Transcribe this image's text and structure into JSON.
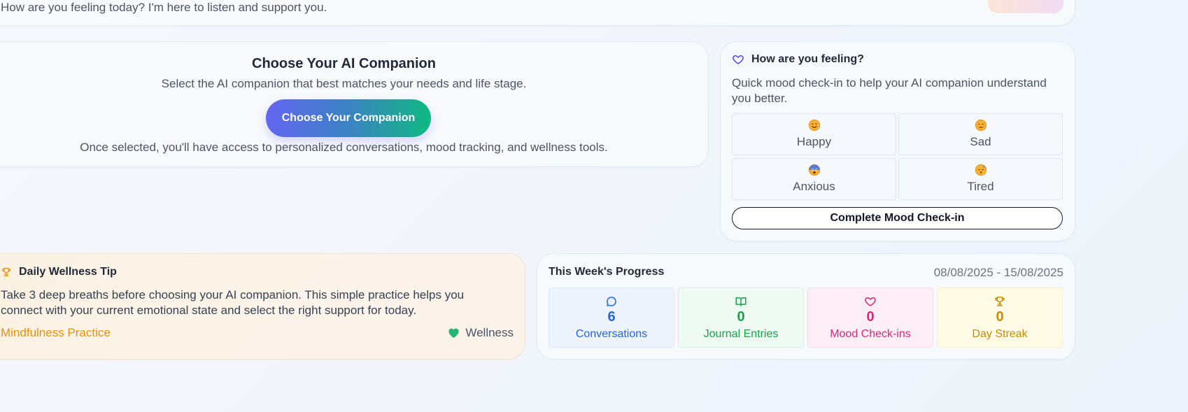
{
  "header": {
    "welcome_text": "How are you feeling today? I'm here to listen and support you."
  },
  "companion": {
    "title": "Choose Your AI Companion",
    "subtitle": "Select the AI companion that best matches your needs and life stage.",
    "button_label": "Choose Your Companion",
    "note": "Once selected, you'll have access to personalized conversations, mood tracking, and wellness tools."
  },
  "mood": {
    "title": "How are you feeling?",
    "description": "Quick mood check-in to help your AI companion understand you better.",
    "options": [
      {
        "label": "Happy",
        "icon": "happy-face-icon"
      },
      {
        "label": "Sad",
        "icon": "sad-face-icon"
      },
      {
        "label": "Anxious",
        "icon": "anxious-face-icon"
      },
      {
        "label": "Tired",
        "icon": "tired-face-icon"
      }
    ],
    "complete_label": "Complete Mood Check-in"
  },
  "tip": {
    "title": "Daily Wellness Tip",
    "text": "Take 3 deep breaths before choosing your AI companion. This simple practice helps you connect with your current emotional state and select the right support for today.",
    "category": "Mindfulness Practice",
    "tag": "Wellness"
  },
  "progress": {
    "title": "This Week's Progress",
    "date_range": "08/08/2025 - 15/08/2025",
    "stats": [
      {
        "value": "6",
        "label": "Conversations",
        "icon": "chat-bubble-icon",
        "color": "#2563eb",
        "bg": "#eef4fd"
      },
      {
        "value": "0",
        "label": "Journal Entries",
        "icon": "book-icon",
        "color": "#16a34a",
        "bg": "#eefaf2"
      },
      {
        "value": "0",
        "label": "Mood Check-ins",
        "icon": "heart-icon",
        "color": "#db2777",
        "bg": "#fdeff5"
      },
      {
        "value": "0",
        "label": "Day Streak",
        "icon": "trophy-icon",
        "color": "#ca8a04",
        "bg": "#fdfbe6"
      }
    ]
  },
  "colors": {
    "accent_indigo": "#6366f1",
    "accent_green": "#10b981",
    "tip_orange": "#e8910c"
  }
}
